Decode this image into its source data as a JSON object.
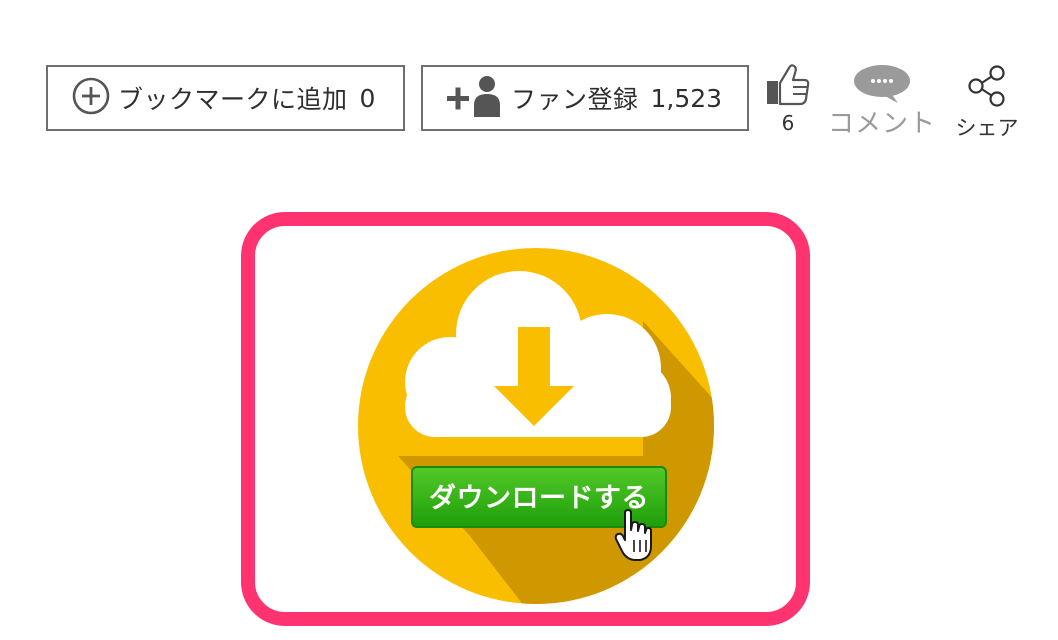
{
  "toolbar": {
    "bookmark": {
      "label": "ブックマークに追加",
      "count": "0",
      "icon": "plus-circle-icon"
    },
    "fan": {
      "label": "ファン登録",
      "count": "1,523",
      "icon": "add-user-icon"
    },
    "like": {
      "count": "6",
      "icon": "thumbs-up-icon"
    },
    "comment": {
      "label": "コメント",
      "icon": "speech-bubble-icon"
    },
    "share": {
      "label": "シェア",
      "icon": "share-icon"
    }
  },
  "download_card": {
    "button_label": "ダウンロードする",
    "icons": [
      "cloud-icon",
      "download-arrow-icon",
      "hand-pointer-icon"
    ],
    "colors": {
      "border": "#ff3370",
      "circle": "#f9be00",
      "shadow": "#cf9800",
      "button": "#2db10f",
      "cloud": "#ffffff"
    }
  }
}
